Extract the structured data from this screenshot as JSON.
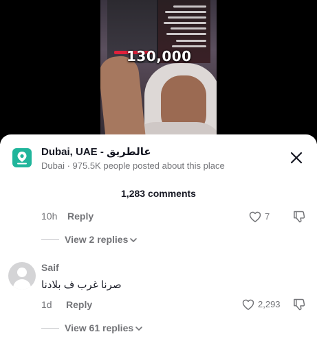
{
  "video": {
    "overlay_number": "130,000"
  },
  "place": {
    "title": "Dubai, UAE - عالطريق",
    "subtitle": "Dubai · 975.5K people posted about this place"
  },
  "comments_header": "1,283 comments",
  "comment1": {
    "time": "10h",
    "reply_label": "Reply",
    "like_count": "7",
    "view_replies": "View 2 replies"
  },
  "comment2": {
    "username": "Saif",
    "text": "صرنا غرب ف بلادنا",
    "time": "1d",
    "reply_label": "Reply",
    "like_count": "2,293",
    "view_replies": "View 61 replies"
  },
  "colors": {
    "accent_place_icon": "#20b59b",
    "text_primary": "#161823",
    "text_secondary": "#737478"
  }
}
